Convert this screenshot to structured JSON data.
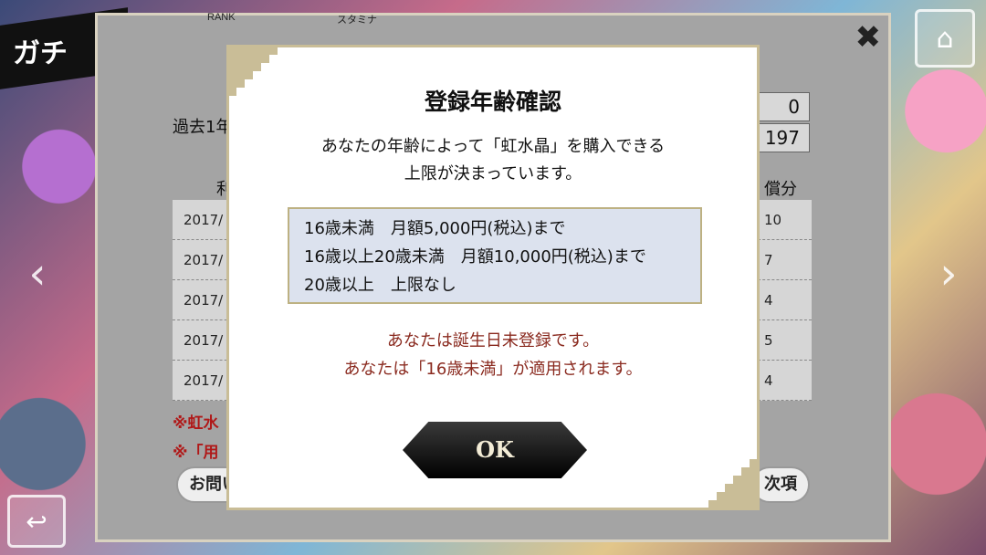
{
  "background": {
    "title_fragment": "ガチ"
  },
  "panel": {
    "rank_label": "RANK",
    "stamina_label": "スタミナ",
    "past_label_fragment": "過去1年",
    "value_1": "0",
    "value_2": "197",
    "col_left_fragment": "利",
    "col_right_fragment": "償分",
    "rows_left": [
      "2017/",
      "2017/",
      "2017/",
      "2017/",
      "2017/"
    ],
    "rows_right": [
      "10",
      "7",
      "4",
      "5",
      "4"
    ],
    "note_1_fragment": "※虹水",
    "note_2_fragment": "※「用",
    "contact_button_fragment": "お問い",
    "next_button": "次項"
  },
  "modal": {
    "title": "登録年齢確認",
    "description_line1": "あなたの年齢によって「虹水晶」を購入できる",
    "description_line2": "上限が決まっています。",
    "rules": [
      "16歳未満　月額5,000円(税込)まで",
      "16歳以上20歳未満　月額10,000円(税込)まで",
      "20歳以上　上限なし"
    ],
    "status_line1": "あなたは誕生日未登録です。",
    "status_line2": "あなたは「16歳未満」が適用されます。",
    "ok_label": "OK"
  },
  "colors": {
    "accent_gold": "#c9bd97",
    "status_red": "#8a2a1f",
    "rule_box_bg": "#dce2ee"
  }
}
